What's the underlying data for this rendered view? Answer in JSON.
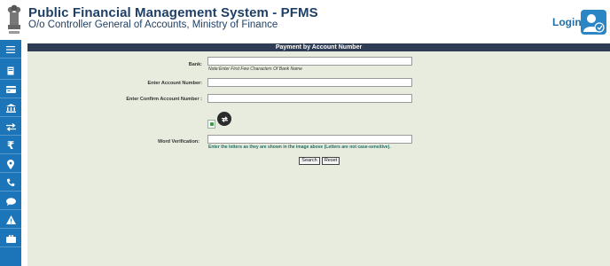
{
  "header": {
    "title": "Public Financial Management System - PFMS",
    "subtitle": "O/o Controller General of Accounts, Ministry of Finance",
    "login_label": "Login"
  },
  "sidebar": {
    "items": [
      {
        "icon": "menu-icon"
      },
      {
        "icon": "book-icon"
      },
      {
        "icon": "card-icon"
      },
      {
        "icon": "bank-icon"
      },
      {
        "icon": "transfer-icon"
      },
      {
        "icon": "rupee-icon",
        "glyph": "₹"
      },
      {
        "icon": "location-icon"
      },
      {
        "icon": "phone-icon"
      },
      {
        "icon": "chat-icon"
      },
      {
        "icon": "warning-icon"
      },
      {
        "icon": "briefcase-icon"
      }
    ]
  },
  "form": {
    "title": "Payment by Account Number",
    "bank_label": "Bank:",
    "bank_value": "",
    "bank_note": "Note:Enter First Few Characters Of Bank Name",
    "account_label": "Enter Account Number:",
    "account_value": "",
    "confirm_label": "Enter Confirm Account Number :",
    "confirm_value": "",
    "word_label": "Word Verification:",
    "word_value": "",
    "word_hint": "Enter the letters as they are shown in the image above (Letters are not case-sensitive).",
    "search_label": "Search",
    "reset_label": "Reset"
  },
  "colors": {
    "brand_blue": "#1b75b8",
    "title_navy": "#1e3f66",
    "panel_bar": "#2e3d55",
    "panel_bg": "#e8ecde",
    "hint_green": "#1f6e64"
  }
}
